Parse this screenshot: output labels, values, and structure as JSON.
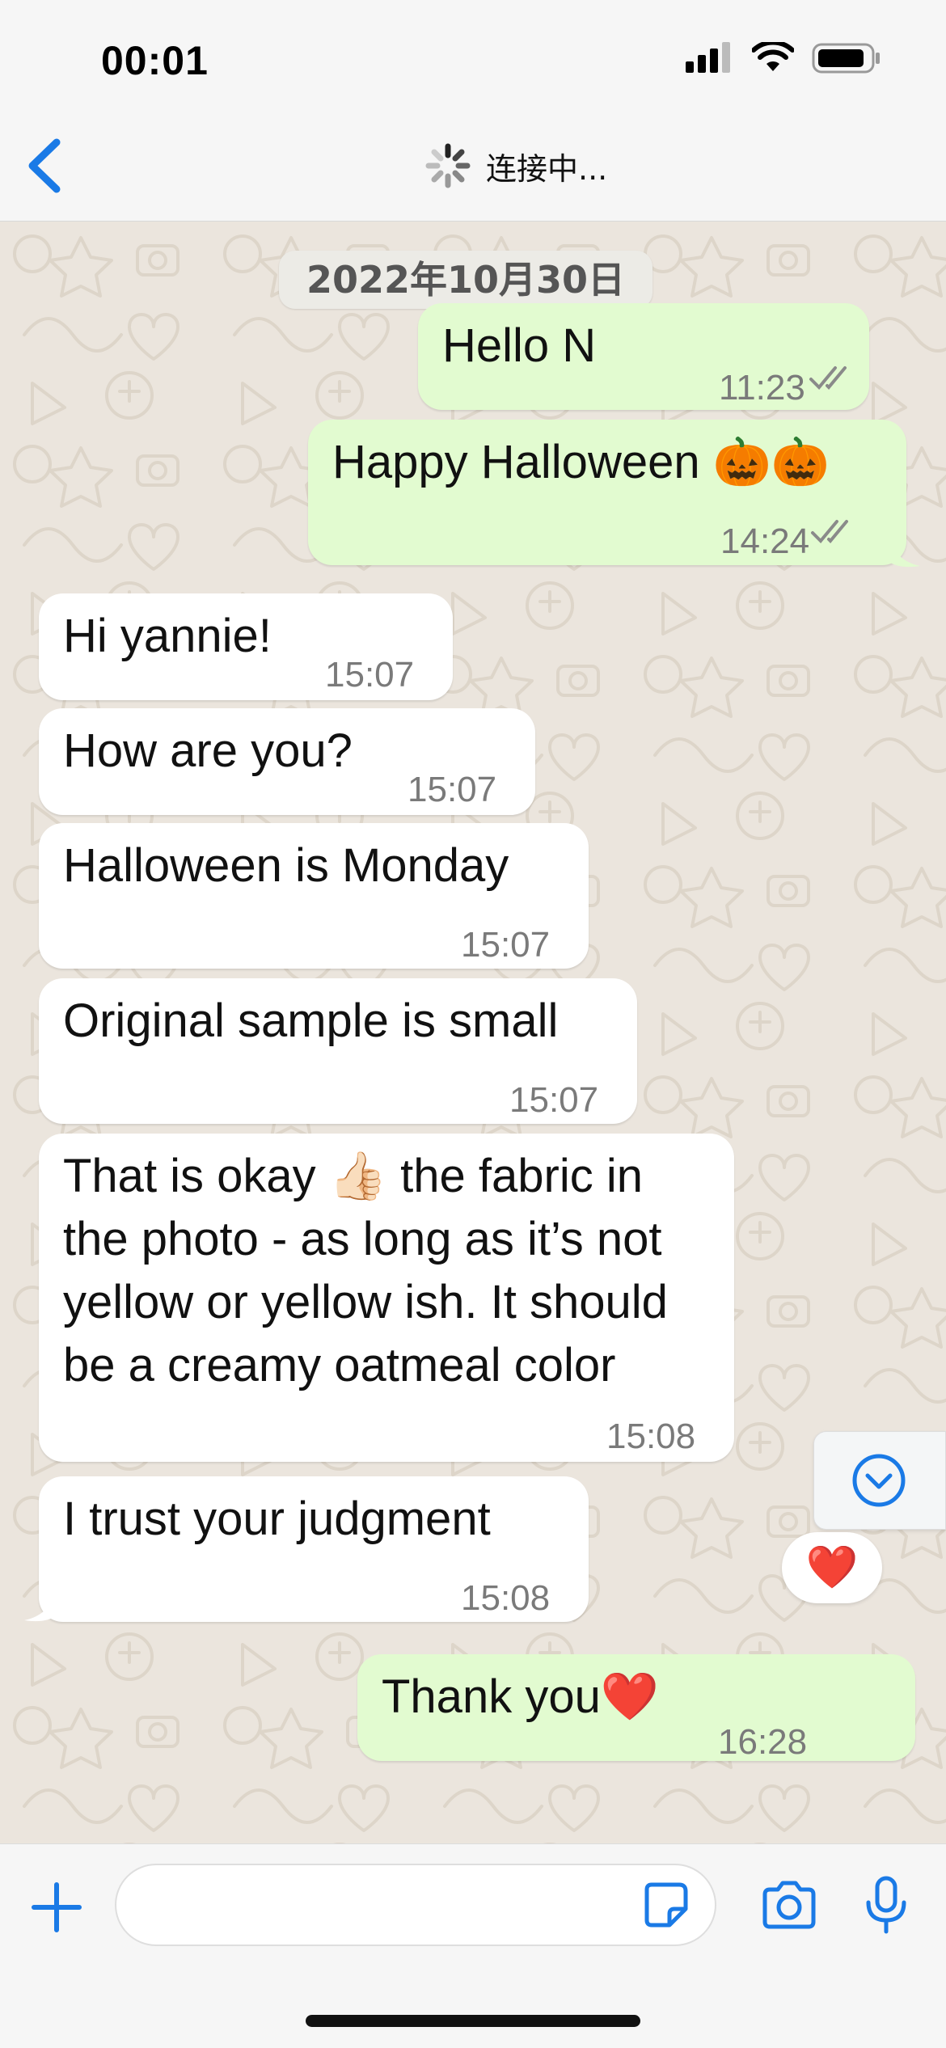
{
  "status": {
    "time": "00:01"
  },
  "nav": {
    "title": "连接中..."
  },
  "date_separator": "2022年10月30日",
  "messages": [
    {
      "direction": "outgoing",
      "text": "Hello N",
      "time": "11:23",
      "status": "read"
    },
    {
      "direction": "outgoing",
      "text": "Happy Halloween 🎃🎃",
      "time": "14:24",
      "status": "read"
    },
    {
      "direction": "incoming",
      "text": "Hi yannie!",
      "time": "15:07"
    },
    {
      "direction": "incoming",
      "text": "How are you?",
      "time": "15:07"
    },
    {
      "direction": "incoming",
      "text": "Halloween is Monday",
      "time": "15:07"
    },
    {
      "direction": "incoming",
      "text": "Original sample is small",
      "time": "15:07"
    },
    {
      "direction": "incoming",
      "text": "That is okay 👍🏻 the fabric in\nthe photo - as long as it’s not\nyellow or yellow ish. It should\nbe a creamy oatmeal color",
      "time": "15:08"
    },
    {
      "direction": "incoming",
      "text": "I trust your judgment",
      "time": "15:08"
    },
    {
      "direction": "outgoing",
      "text": "Thank you❤️",
      "time": "16:28",
      "status": "sent"
    }
  ],
  "reaction": "❤️",
  "input": {
    "placeholder": ""
  },
  "colors": {
    "accent": "#1a7ae6",
    "outgoing_bubble": "#e2fbd0",
    "incoming_bubble": "#ffffff",
    "chat_bg": "#ebe5dd",
    "read_ticks": "#8a8a8a"
  },
  "icons": [
    "back-chevron-icon",
    "loading-spinner-icon",
    "signal-icon",
    "wifi-icon",
    "battery-icon",
    "double-check-icon",
    "scroll-down-icon",
    "plus-icon",
    "sticker-icon",
    "camera-icon",
    "microphone-icon"
  ]
}
